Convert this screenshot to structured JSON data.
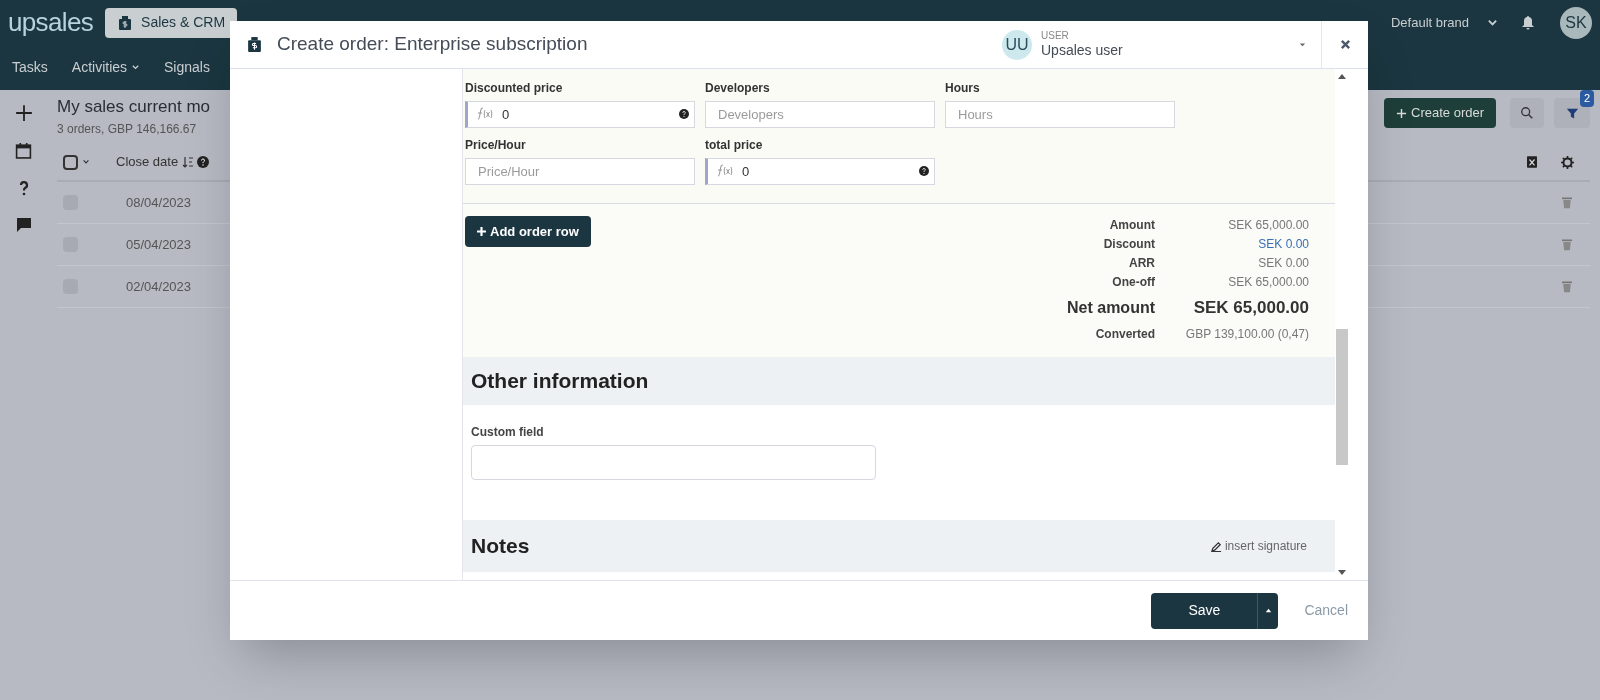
{
  "app": {
    "logo": "upsales",
    "nav_tabs": [
      {
        "label": "Sales & CRM",
        "selected": true
      }
    ],
    "brand": "Default brand",
    "avatar": "SK",
    "subnav": [
      {
        "label": "Tasks",
        "caret": false
      },
      {
        "label": "Activities",
        "caret": true
      },
      {
        "label": "Signals",
        "caret": false
      }
    ]
  },
  "list": {
    "title": "My sales current mo",
    "all_selected": false,
    "subtitle": "3 orders, GBP 146,166.67",
    "columns": [
      {
        "label": "Close date"
      }
    ],
    "rows": [
      {
        "close_date": "08/04/2023",
        "checked": false
      },
      {
        "close_date": "05/04/2023",
        "checked": false
      },
      {
        "close_date": "02/04/2023",
        "checked": false
      }
    ],
    "create_button": "Create order",
    "filter_count": "2"
  },
  "modal": {
    "title": "Create order: Enterprise subscription",
    "user": {
      "initials": "UU",
      "label": "USER",
      "name": "Upsales user"
    },
    "fields": [
      {
        "label": "Discounted price",
        "kind": "formula",
        "value": "0"
      },
      {
        "label": "Developers",
        "kind": "text",
        "placeholder": "Developers"
      },
      {
        "label": "Hours",
        "kind": "text",
        "placeholder": "Hours"
      },
      {
        "label": "Price/Hour",
        "kind": "text",
        "placeholder": "Price/Hour"
      },
      {
        "label": "total price",
        "kind": "formula",
        "value": "0"
      }
    ],
    "add_row_button": "Add order row",
    "summary": [
      {
        "label": "Amount",
        "value": "SEK 65,000.00",
        "kind": "plain"
      },
      {
        "label": "Discount",
        "value": "SEK 0.00",
        "kind": "link"
      },
      {
        "label": "ARR",
        "value": "SEK 0.00",
        "kind": "plain"
      },
      {
        "label": "One-off",
        "value": "SEK 65,000.00",
        "kind": "plain"
      },
      {
        "label": "Net amount",
        "value": "SEK 65,000.00",
        "kind": "total"
      },
      {
        "label": "Converted",
        "value": "GBP 139,100.00 (0,47)",
        "kind": "plain"
      }
    ],
    "other_information": {
      "title": "Other information",
      "fields": [
        {
          "label": "Custom field"
        }
      ]
    },
    "notes": {
      "title": "Notes",
      "link": "insert signature"
    },
    "footer": {
      "save": "Save",
      "cancel": "Cancel"
    }
  }
}
